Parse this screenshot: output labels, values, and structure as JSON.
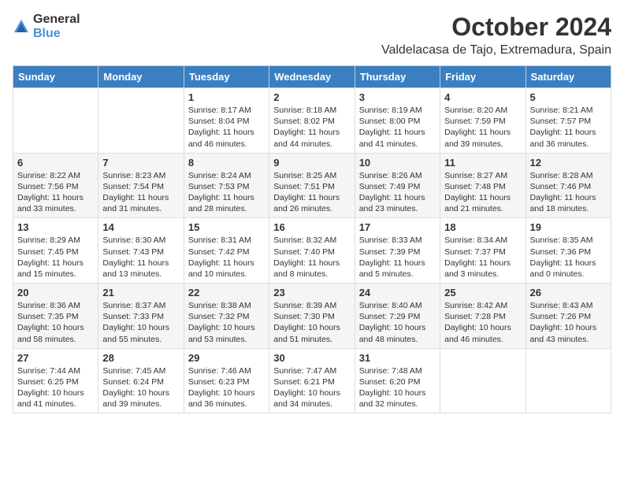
{
  "logo": {
    "general": "General",
    "blue": "Blue"
  },
  "title": "October 2024",
  "location": "Valdelacasa de Tajo, Extremadura, Spain",
  "weekdays": [
    "Sunday",
    "Monday",
    "Tuesday",
    "Wednesday",
    "Thursday",
    "Friday",
    "Saturday"
  ],
  "weeks": [
    [
      {
        "day": "",
        "sunrise": "",
        "sunset": "",
        "daylight": ""
      },
      {
        "day": "",
        "sunrise": "",
        "sunset": "",
        "daylight": ""
      },
      {
        "day": "1",
        "sunrise": "Sunrise: 8:17 AM",
        "sunset": "Sunset: 8:04 PM",
        "daylight": "Daylight: 11 hours and 46 minutes."
      },
      {
        "day": "2",
        "sunrise": "Sunrise: 8:18 AM",
        "sunset": "Sunset: 8:02 PM",
        "daylight": "Daylight: 11 hours and 44 minutes."
      },
      {
        "day": "3",
        "sunrise": "Sunrise: 8:19 AM",
        "sunset": "Sunset: 8:00 PM",
        "daylight": "Daylight: 11 hours and 41 minutes."
      },
      {
        "day": "4",
        "sunrise": "Sunrise: 8:20 AM",
        "sunset": "Sunset: 7:59 PM",
        "daylight": "Daylight: 11 hours and 39 minutes."
      },
      {
        "day": "5",
        "sunrise": "Sunrise: 8:21 AM",
        "sunset": "Sunset: 7:57 PM",
        "daylight": "Daylight: 11 hours and 36 minutes."
      }
    ],
    [
      {
        "day": "6",
        "sunrise": "Sunrise: 8:22 AM",
        "sunset": "Sunset: 7:56 PM",
        "daylight": "Daylight: 11 hours and 33 minutes."
      },
      {
        "day": "7",
        "sunrise": "Sunrise: 8:23 AM",
        "sunset": "Sunset: 7:54 PM",
        "daylight": "Daylight: 11 hours and 31 minutes."
      },
      {
        "day": "8",
        "sunrise": "Sunrise: 8:24 AM",
        "sunset": "Sunset: 7:53 PM",
        "daylight": "Daylight: 11 hours and 28 minutes."
      },
      {
        "day": "9",
        "sunrise": "Sunrise: 8:25 AM",
        "sunset": "Sunset: 7:51 PM",
        "daylight": "Daylight: 11 hours and 26 minutes."
      },
      {
        "day": "10",
        "sunrise": "Sunrise: 8:26 AM",
        "sunset": "Sunset: 7:49 PM",
        "daylight": "Daylight: 11 hours and 23 minutes."
      },
      {
        "day": "11",
        "sunrise": "Sunrise: 8:27 AM",
        "sunset": "Sunset: 7:48 PM",
        "daylight": "Daylight: 11 hours and 21 minutes."
      },
      {
        "day": "12",
        "sunrise": "Sunrise: 8:28 AM",
        "sunset": "Sunset: 7:46 PM",
        "daylight": "Daylight: 11 hours and 18 minutes."
      }
    ],
    [
      {
        "day": "13",
        "sunrise": "Sunrise: 8:29 AM",
        "sunset": "Sunset: 7:45 PM",
        "daylight": "Daylight: 11 hours and 15 minutes."
      },
      {
        "day": "14",
        "sunrise": "Sunrise: 8:30 AM",
        "sunset": "Sunset: 7:43 PM",
        "daylight": "Daylight: 11 hours and 13 minutes."
      },
      {
        "day": "15",
        "sunrise": "Sunrise: 8:31 AM",
        "sunset": "Sunset: 7:42 PM",
        "daylight": "Daylight: 11 hours and 10 minutes."
      },
      {
        "day": "16",
        "sunrise": "Sunrise: 8:32 AM",
        "sunset": "Sunset: 7:40 PM",
        "daylight": "Daylight: 11 hours and 8 minutes."
      },
      {
        "day": "17",
        "sunrise": "Sunrise: 8:33 AM",
        "sunset": "Sunset: 7:39 PM",
        "daylight": "Daylight: 11 hours and 5 minutes."
      },
      {
        "day": "18",
        "sunrise": "Sunrise: 8:34 AM",
        "sunset": "Sunset: 7:37 PM",
        "daylight": "Daylight: 11 hours and 3 minutes."
      },
      {
        "day": "19",
        "sunrise": "Sunrise: 8:35 AM",
        "sunset": "Sunset: 7:36 PM",
        "daylight": "Daylight: 11 hours and 0 minutes."
      }
    ],
    [
      {
        "day": "20",
        "sunrise": "Sunrise: 8:36 AM",
        "sunset": "Sunset: 7:35 PM",
        "daylight": "Daylight: 10 hours and 58 minutes."
      },
      {
        "day": "21",
        "sunrise": "Sunrise: 8:37 AM",
        "sunset": "Sunset: 7:33 PM",
        "daylight": "Daylight: 10 hours and 55 minutes."
      },
      {
        "day": "22",
        "sunrise": "Sunrise: 8:38 AM",
        "sunset": "Sunset: 7:32 PM",
        "daylight": "Daylight: 10 hours and 53 minutes."
      },
      {
        "day": "23",
        "sunrise": "Sunrise: 8:39 AM",
        "sunset": "Sunset: 7:30 PM",
        "daylight": "Daylight: 10 hours and 51 minutes."
      },
      {
        "day": "24",
        "sunrise": "Sunrise: 8:40 AM",
        "sunset": "Sunset: 7:29 PM",
        "daylight": "Daylight: 10 hours and 48 minutes."
      },
      {
        "day": "25",
        "sunrise": "Sunrise: 8:42 AM",
        "sunset": "Sunset: 7:28 PM",
        "daylight": "Daylight: 10 hours and 46 minutes."
      },
      {
        "day": "26",
        "sunrise": "Sunrise: 8:43 AM",
        "sunset": "Sunset: 7:26 PM",
        "daylight": "Daylight: 10 hours and 43 minutes."
      }
    ],
    [
      {
        "day": "27",
        "sunrise": "Sunrise: 7:44 AM",
        "sunset": "Sunset: 6:25 PM",
        "daylight": "Daylight: 10 hours and 41 minutes."
      },
      {
        "day": "28",
        "sunrise": "Sunrise: 7:45 AM",
        "sunset": "Sunset: 6:24 PM",
        "daylight": "Daylight: 10 hours and 39 minutes."
      },
      {
        "day": "29",
        "sunrise": "Sunrise: 7:46 AM",
        "sunset": "Sunset: 6:23 PM",
        "daylight": "Daylight: 10 hours and 36 minutes."
      },
      {
        "day": "30",
        "sunrise": "Sunrise: 7:47 AM",
        "sunset": "Sunset: 6:21 PM",
        "daylight": "Daylight: 10 hours and 34 minutes."
      },
      {
        "day": "31",
        "sunrise": "Sunrise: 7:48 AM",
        "sunset": "Sunset: 6:20 PM",
        "daylight": "Daylight: 10 hours and 32 minutes."
      },
      {
        "day": "",
        "sunrise": "",
        "sunset": "",
        "daylight": ""
      },
      {
        "day": "",
        "sunrise": "",
        "sunset": "",
        "daylight": ""
      }
    ]
  ]
}
